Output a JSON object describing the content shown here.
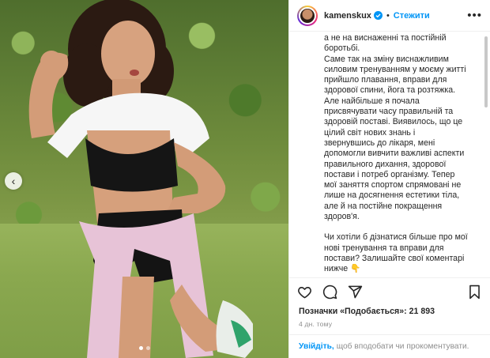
{
  "post": {
    "author": {
      "username": "kamenskux",
      "follow_label": "Стежити",
      "separator": "•",
      "more_label": "•••"
    },
    "caption": {
      "paragraph_1": "а не на виснаженні та постійній\nборотьбі.\nСаме так на зміну виснажливим\nсиловим тренуванням у моєму житті\nприйшло плавання, вправи для\nздорової спини, йога та розтяжка.\nАле найбільше я почала\nприсвячувати часу правильній та\nздоровій поставі. Виявилось, що це\nцілий світ нових знань і\nзвернувшись до лікаря, мені\nдопомогли вивчити важливі аспекти\nправильного дихання, здорової\nпостави і потреб організму. Тепер\nмої заняття спортом спрямовані не\nлише на досягнення естетики тіла,\nале й на постійне покращення\nздоров'я.",
      "paragraph_2": "Чи хотіли б дізнатися більше про мої\nнові тренування та вправи для\nпостави? Залишайте свої коментарі\nнижче 👇"
    },
    "likes_text": "Позначки «Подобається»: 21 893",
    "timestamp": "4 дн. тому",
    "login_prompt": {
      "link": "Увійдіть,",
      "text": "щоб вподобати чи прокоментувати."
    },
    "carousel": {
      "prev_arrow": "‹",
      "slide_count": 2,
      "active_slide": 1
    }
  },
  "colors": {
    "accent": "#0095f6",
    "text": "#262626",
    "muted": "#8e8e8e",
    "border": "#efefef"
  },
  "icons": [
    "heart-icon",
    "comment-icon",
    "share-icon",
    "bookmark-icon",
    "verified-icon",
    "chevron-left-icon"
  ]
}
